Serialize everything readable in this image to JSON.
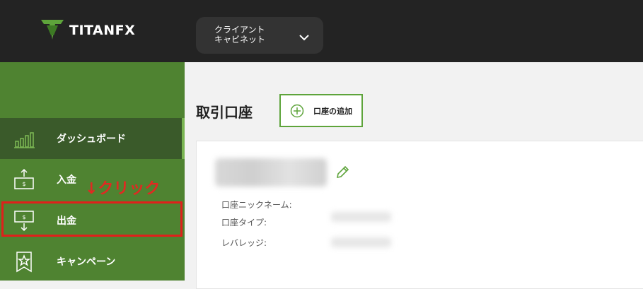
{
  "brand": {
    "name": "TITANFX",
    "accent": "#5ea43b"
  },
  "header": {
    "cabinet_label": "クライアント\nキャビネット"
  },
  "sidebar": {
    "items": [
      {
        "label": "ダッシュボード",
        "icon": "bar-chart-icon",
        "active": true
      },
      {
        "label": "入金",
        "icon": "deposit-icon"
      },
      {
        "label": "出金",
        "icon": "withdraw-icon"
      },
      {
        "label": "キャンペーン",
        "icon": "star-badge-icon"
      }
    ]
  },
  "annotation": {
    "text": "↓クリック",
    "color": "#e02a22"
  },
  "main": {
    "title": "取引口座",
    "add_account_label": "口座の追加",
    "fields": [
      {
        "label": "口座ニックネーム:"
      },
      {
        "label": "口座タイプ:"
      },
      {
        "label": "レバレッジ:"
      }
    ]
  }
}
